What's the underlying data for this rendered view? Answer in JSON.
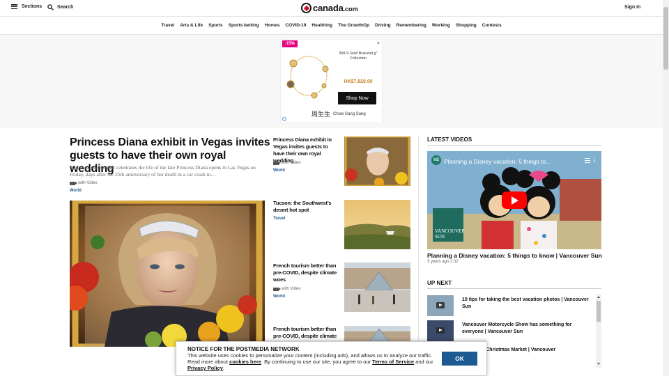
{
  "header": {
    "sections_label": "Sections",
    "search_label": "Search",
    "logo_text": "canada",
    "logo_suffix": ".com",
    "signin_label": "Sign In"
  },
  "nav": [
    "Travel",
    "Arts & Life",
    "Sports",
    "Sports betting",
    "Homes",
    "COVID-19",
    "Healthing",
    "The GrowthOp",
    "Driving",
    "Remembering",
    "Working",
    "Shopping",
    "Contests"
  ],
  "ad": {
    "badge": "-15%",
    "close": "×",
    "title": "999.9 Gold Bracelet g\" Collection",
    "price": "HK$7,820.00",
    "cta": "Shop Now",
    "brand_cn": "周生生",
    "brand_en": "Chow Sang Sang"
  },
  "feature": {
    "title": "Princess Diana exhibit in Vegas invites guests to have their own royal wedding",
    "description": "A new exhibition that celebrates the life of the late Princess Diana opens in Las Vegas on Friday, days after the 25th anniversary of her death in a car crash in…",
    "video_label": "with Video",
    "category": "World"
  },
  "cards": [
    {
      "title": "Princess Diana exhibit in Vegas invites guests to have their own royal wedding",
      "video_label": "with Video",
      "category": "World"
    },
    {
      "title": "Tucson: the Southwest’s desert hot spot",
      "video_label": "",
      "category": "Travel"
    },
    {
      "title": "French tourism better than pre-COVID, despite climate woes",
      "video_label": "with Video",
      "category": "World"
    },
    {
      "title": "French tourism better than pre-COVID, despite climate",
      "video_label": "",
      "category": ""
    }
  ],
  "latest_videos": {
    "heading": "LATEST VIDEOS",
    "player_title": "Planning a Disney vacation: 5 things to…",
    "channel_badge": "VS",
    "logo_line1": "VANCOUVER",
    "logo_line2": "SUN",
    "caption": "Planning a Disney vacation: 5 things to know | Vancouver Sun",
    "meta": "3 years ago  2:32"
  },
  "up_next": {
    "heading": "UP NEXT",
    "items": [
      {
        "title": "10 tips for taking the best vacation photos | Vancouver Sun"
      },
      {
        "title": "Vancouver Motorcycle Show has something for everyone | Vancouver Sun"
      },
      {
        "title": "s German Christmas Market | Vancouver"
      }
    ]
  },
  "notice": {
    "title": "NOTICE FOR THE POSTMEDIA NETWORK",
    "text1": "This website uses cookies to personalize your content (including ads), and allows us to analyze our traffic. Read more about ",
    "link1": "cookies here",
    "text2": ". By continuing to use our site, you agree to our ",
    "link2": "Terms of Service",
    "text3": " and our ",
    "link3": "Privacy Policy",
    "text4": ".",
    "ok_label": "OK"
  },
  "colors": {
    "accent": "#1d5a91",
    "ad_badge": "#e4007f",
    "play": "#ff0000"
  }
}
